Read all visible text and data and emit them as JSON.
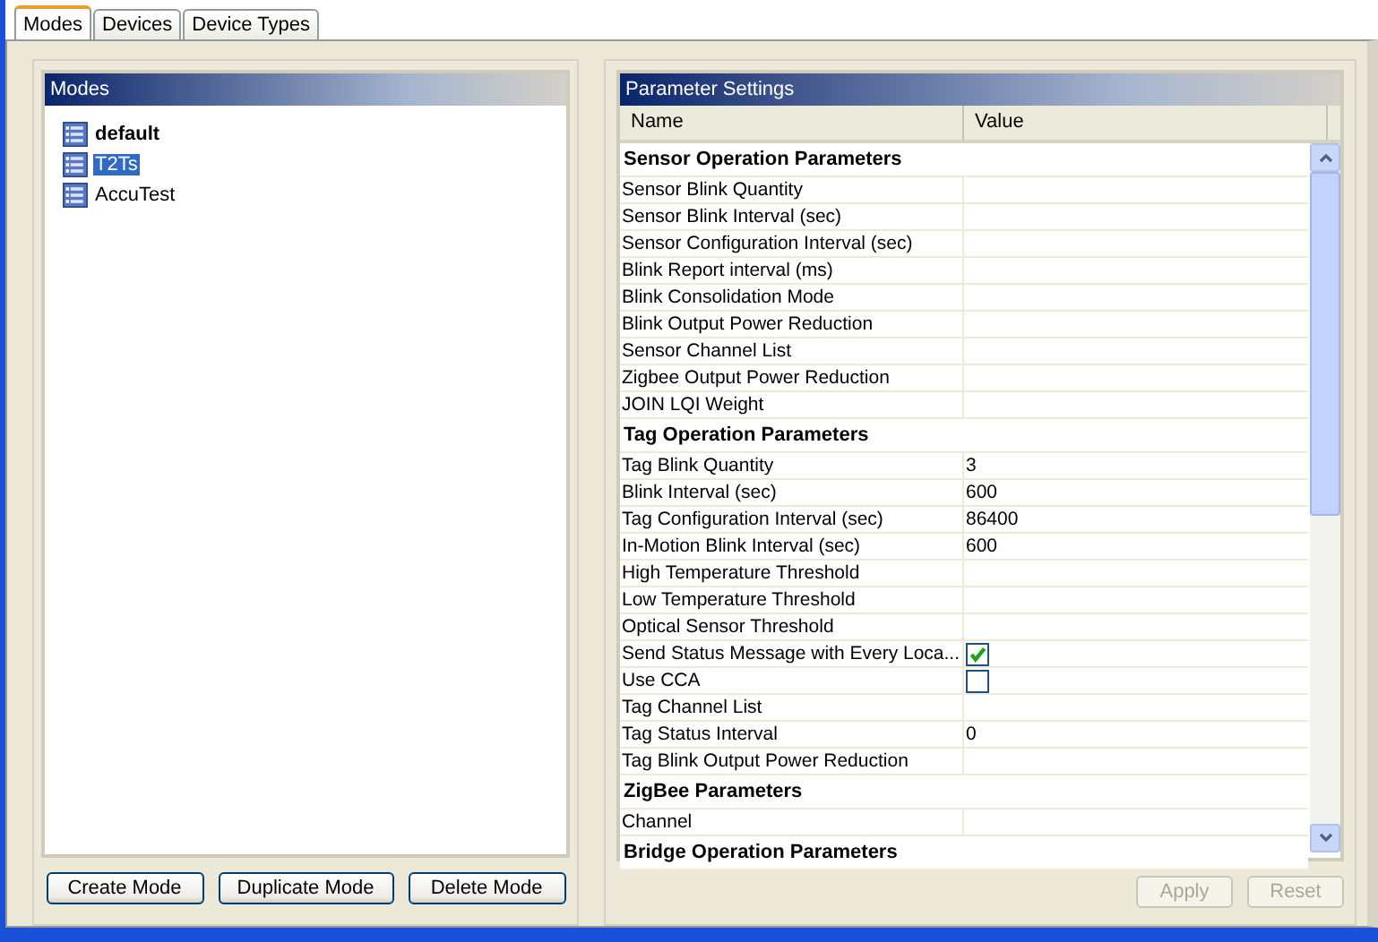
{
  "tabs": [
    {
      "label": "Modes",
      "selected": true
    },
    {
      "label": "Devices",
      "selected": false
    },
    {
      "label": "Device Types",
      "selected": false
    }
  ],
  "modes_panel": {
    "title": "Modes",
    "items": [
      {
        "label": "default",
        "is_default": true,
        "selected": false
      },
      {
        "label": "T2Ts",
        "is_default": false,
        "selected": true
      },
      {
        "label": "AccuTest",
        "is_default": false,
        "selected": false
      }
    ],
    "buttons": [
      {
        "label": "Create Mode",
        "disabled": false
      },
      {
        "label": "Duplicate Mode",
        "disabled": false
      },
      {
        "label": "Delete Mode",
        "disabled": false
      }
    ]
  },
  "parameter_panel": {
    "title": "Parameter Settings",
    "columns": [
      "Name",
      "Value"
    ],
    "sections": [
      {
        "title": "Sensor Operation Parameters",
        "params": [
          {
            "name": "Sensor Blink Quantity",
            "kind": "text"
          },
          {
            "name": "Sensor Blink Interval (sec)",
            "kind": "text"
          },
          {
            "name": "Sensor Configuration Interval (sec)",
            "kind": "text"
          },
          {
            "name": "Blink Report interval (ms)",
            "kind": "text"
          },
          {
            "name": "Blink Consolidation Mode",
            "kind": "text"
          },
          {
            "name": "Blink Output Power Reduction",
            "kind": "text"
          },
          {
            "name": "Sensor Channel List",
            "kind": "text"
          },
          {
            "name": "Zigbee Output Power Reduction",
            "kind": "text"
          },
          {
            "name": "JOIN LQI Weight",
            "kind": "text"
          }
        ]
      },
      {
        "title": "Tag Operation Parameters",
        "params": [
          {
            "name": "Tag Blink Quantity",
            "kind": "text",
            "value": "3"
          },
          {
            "name": "Blink Interval (sec)",
            "kind": "text",
            "value": "600"
          },
          {
            "name": "Tag Configuration Interval (sec)",
            "kind": "text",
            "value": "86400"
          },
          {
            "name": "In-Motion Blink Interval (sec)",
            "kind": "text",
            "value": "600"
          },
          {
            "name": "High Temperature Threshold",
            "kind": "text"
          },
          {
            "name": "Low Temperature Threshold",
            "kind": "text"
          },
          {
            "name": "Optical Sensor Threshold",
            "kind": "text"
          },
          {
            "name": "Send Status Message with Every Loca...",
            "kind": "checkbox",
            "checked": true
          },
          {
            "name": "Use CCA",
            "kind": "checkbox",
            "checked": false
          },
          {
            "name": "Tag Channel List",
            "kind": "text"
          },
          {
            "name": "Tag Status Interval",
            "kind": "text",
            "value": "0"
          },
          {
            "name": "Tag Blink Output Power Reduction",
            "kind": "text"
          }
        ]
      },
      {
        "title": "ZigBee Parameters",
        "params": [
          {
            "name": "Channel",
            "kind": "text"
          }
        ]
      },
      {
        "title": "Bridge Operation Parameters"
      }
    ],
    "buttons": [
      {
        "label": "Apply",
        "disabled": true
      },
      {
        "label": "Reset",
        "disabled": true
      }
    ]
  }
}
